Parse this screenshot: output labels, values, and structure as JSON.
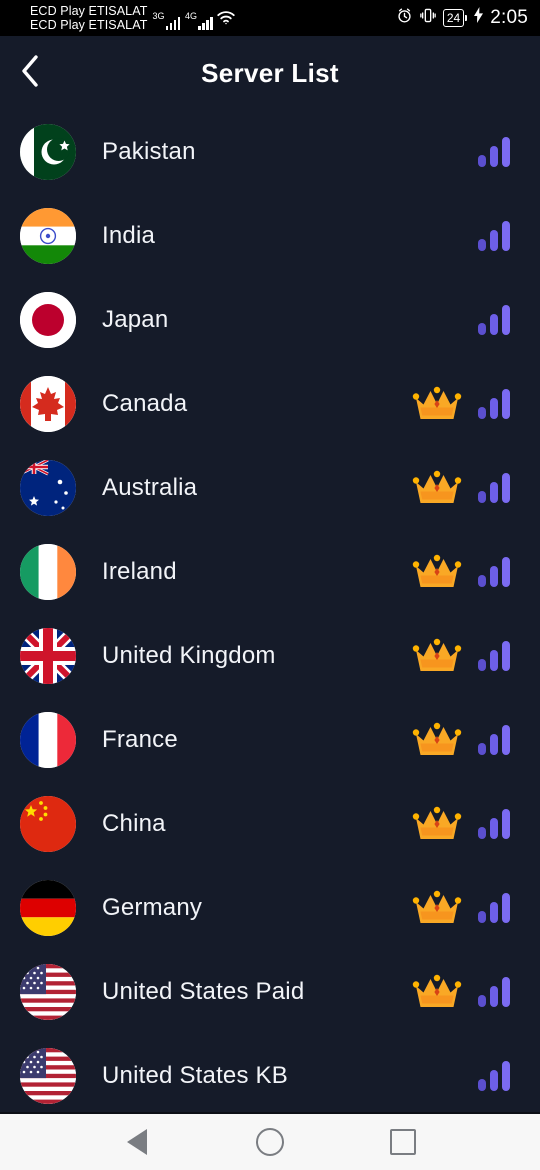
{
  "statusbar": {
    "carrier_line1": "ECD Play ETISALAT",
    "carrier_line2": "ECD Play ETISALAT",
    "network1": "3G",
    "network2": "4G",
    "wifi_icon": "wifi-icon",
    "alarm_icon": "alarm-clock-icon",
    "vibrate_icon": "vibrate-icon",
    "battery_level": "24",
    "charging_icon": "charging-bolt-icon",
    "time": "2:05"
  },
  "header": {
    "back_icon": "chevron-left-icon",
    "title": "Server List"
  },
  "colors": {
    "background": "#151b29",
    "status_background": "#000000",
    "title_text": "#ffffff",
    "item_text": "#f2f4f8",
    "signal_accent": "#6c5ce7",
    "crown_gold": "#f5a623",
    "navbar_background": "#f7f7f7",
    "navbar_icon": "#7a7d82"
  },
  "server_list": {
    "signal_icon": "signal-bars-icon",
    "premium_icon": "crown-icon",
    "items": [
      {
        "name": "Pakistan",
        "flag": "flag-pakistan",
        "premium": false
      },
      {
        "name": "India",
        "flag": "flag-india",
        "premium": false
      },
      {
        "name": "Japan",
        "flag": "flag-japan",
        "premium": false
      },
      {
        "name": "Canada",
        "flag": "flag-canada",
        "premium": true
      },
      {
        "name": "Australia",
        "flag": "flag-australia",
        "premium": true
      },
      {
        "name": "Ireland",
        "flag": "flag-ireland",
        "premium": true
      },
      {
        "name": "United Kingdom",
        "flag": "flag-united-kingdom",
        "premium": true
      },
      {
        "name": "France",
        "flag": "flag-france",
        "premium": true
      },
      {
        "name": "China",
        "flag": "flag-china",
        "premium": true
      },
      {
        "name": "Germany",
        "flag": "flag-germany",
        "premium": true
      },
      {
        "name": "United States Paid",
        "flag": "flag-united-states",
        "premium": true
      },
      {
        "name": "United States KB",
        "flag": "flag-united-states",
        "premium": false
      }
    ]
  },
  "navbar": {
    "back_icon": "nav-back-icon",
    "home_icon": "nav-home-icon",
    "recents_icon": "nav-recents-icon"
  }
}
